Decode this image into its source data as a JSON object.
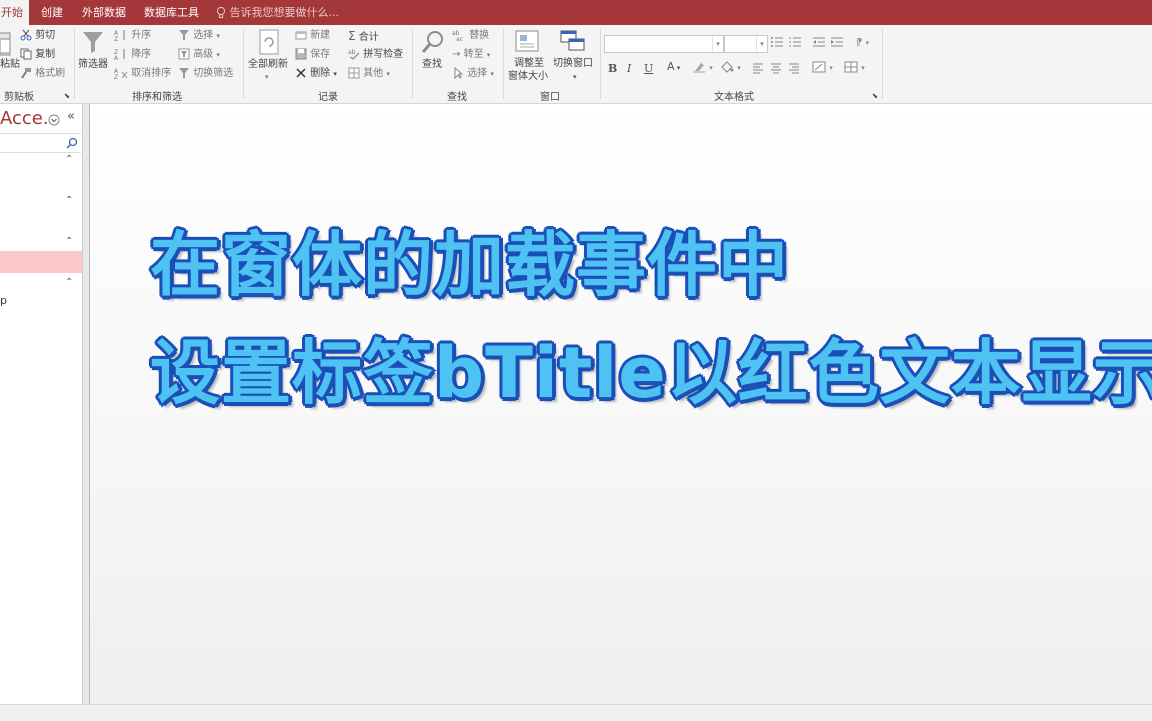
{
  "tabs": {
    "home": "开始",
    "create": "创建",
    "external": "外部数据",
    "dbtools": "数据库工具",
    "tellme": "告诉我您想要做什么..."
  },
  "ribbon": {
    "clipboard": {
      "paste": "粘贴",
      "cut": "剪切",
      "copy": "复制",
      "format_painter": "格式刷",
      "group": "剪贴板"
    },
    "sortfilter": {
      "filter": "筛选器",
      "ascending": "升序",
      "descending": "降序",
      "remove_sort": "取消排序",
      "selection": "选择",
      "advanced": "高级",
      "toggle_filter": "切换筛选",
      "group": "排序和筛选"
    },
    "records": {
      "refresh_all": "全部刷新",
      "new": "新建",
      "save": "保存",
      "delete": "删除",
      "totals": "合计",
      "spelling": "拼写检查",
      "more": "其他",
      "group": "记录"
    },
    "find": {
      "find": "查找",
      "replace": "替换",
      "goto": "转至",
      "select": "选择",
      "group": "查找"
    },
    "window": {
      "size_line1": "调整至",
      "size_line2": "窗体大小",
      "switch": "切换窗口",
      "group": "窗口"
    },
    "textformat": {
      "bold": "B",
      "italic": "I",
      "underline": "U",
      "font_color": "A",
      "group": "文本格式"
    }
  },
  "nav": {
    "title": "Acce...",
    "item_partial": "p"
  },
  "overlay": {
    "line1": "在窗体的加载事件中",
    "line2": "设置标签bTitle以红色文本显示"
  },
  "colors": {
    "accent": "#a4373a",
    "caption_fill": "#4fc2f4",
    "caption_outline": "#1a4fb8",
    "selected_row": "#fbc9c9"
  }
}
